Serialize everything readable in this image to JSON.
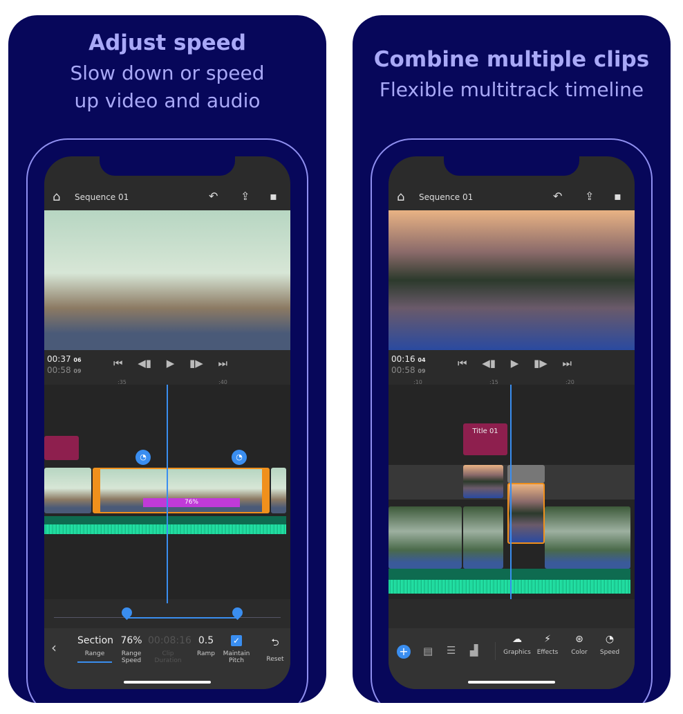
{
  "left": {
    "title": "Adjust speed",
    "subtitle_line1": "Slow down or speed",
    "subtitle_line2": "up video and audio",
    "header": {
      "sequence": "Sequence 01",
      "icons": [
        "home-icon",
        "undo-icon",
        "share-icon",
        "comment-icon"
      ]
    },
    "timecode": {
      "current": "00:37",
      "current_frames": "06",
      "total": "00:58",
      "total_frames": "09"
    },
    "ruler": [
      ":35",
      ":40"
    ],
    "speed_label": "76%",
    "toolbar": [
      {
        "value": "Section",
        "label": "Range",
        "active": true
      },
      {
        "value": "76%",
        "label": "Range Speed"
      },
      {
        "value": "00:08:16",
        "label": "Clip Duration",
        "disabled": true
      },
      {
        "value": "0.5",
        "label": "Ramp"
      },
      {
        "value": "✓",
        "label": "Maintain Pitch",
        "checked": true
      },
      {
        "value": "⮌",
        "label": "Reset"
      }
    ]
  },
  "right": {
    "title": "Combine multiple clips",
    "subtitle": "Flexible multitrack timeline",
    "header": {
      "sequence": "Sequence 01"
    },
    "timecode": {
      "current": "00:16",
      "current_frames": "04",
      "total": "00:58",
      "total_frames": "09"
    },
    "ruler": [
      ":10",
      ":15",
      ":20"
    ],
    "title_clip": "Title 01",
    "toolbar": [
      {
        "label": "Graphics",
        "icon": "graphics-icon"
      },
      {
        "label": "Effects",
        "icon": "effects-icon"
      },
      {
        "label": "Color",
        "icon": "color-icon"
      },
      {
        "label": "Speed",
        "icon": "speed-icon"
      }
    ]
  },
  "colors": {
    "background": "#07075a",
    "title": "#a9a9f7",
    "accent": "#3a8ef0",
    "selection": "#f0901c",
    "speed_bar": "#c03ad8",
    "title_clip": "#8e1f4e",
    "audio": "#1fd69a"
  }
}
